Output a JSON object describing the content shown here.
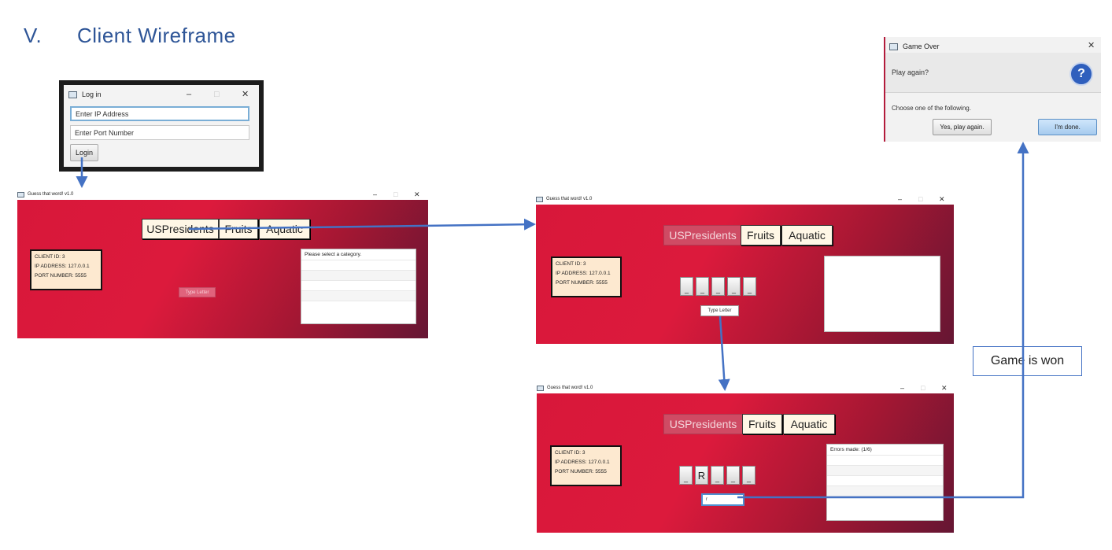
{
  "heading": {
    "number": "V.",
    "title": "Client Wireframe"
  },
  "login_window": {
    "title": "Log in",
    "ip_placeholder": "Enter IP Address",
    "port_placeholder": "Enter Port Number",
    "login_button": "Login"
  },
  "game_window_title": "Guess that word! v1.0",
  "window_controls": {
    "minimize": "–",
    "maximize": "□",
    "close": "✕"
  },
  "categories": [
    "USPresidents",
    "Fruits",
    "Aquatic"
  ],
  "client_info": {
    "client_id": "CLIENT ID: 3",
    "ip_address": "IP ADDRESS: 127.0.0.1",
    "port_number": "PORT NUMBER: 5555"
  },
  "screen1": {
    "panel_text": "Please select a category.",
    "type_letter": "Type Letter"
  },
  "screen2": {
    "type_letter": "Type Letter",
    "tiles": [
      "_",
      "_",
      "_",
      "_",
      "_"
    ]
  },
  "screen3": {
    "panel_text": "Errors made: (1/6)",
    "input_value": "r",
    "tiles": [
      "_",
      "R",
      "_",
      "_",
      "_"
    ]
  },
  "game_over": {
    "title": "Game Over",
    "question": "Play again?",
    "prompt": "Choose one of the following.",
    "yes_button": "Yes, play again.",
    "done_button": "I'm done."
  },
  "callout": "Game is won",
  "colors": {
    "accent": "#4472c4",
    "window_red": "#d8173a",
    "window_dark": "#651633"
  }
}
